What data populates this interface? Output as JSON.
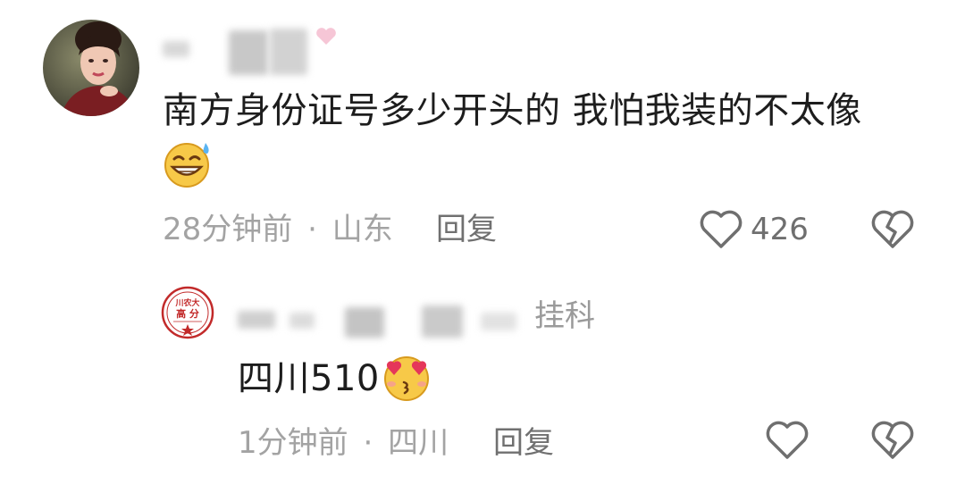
{
  "comment": {
    "text": "南方身份证号多少开头的 我怕我装的不太像",
    "emoji": "grin-sweat-emoji",
    "time": "28分钟前",
    "separator": "·",
    "location": "山东",
    "reply_label": "回复",
    "likes": "426"
  },
  "reply": {
    "author_suffix": "挂科",
    "text": "四川510",
    "emoji": "heart-eyes-kiss-emoji",
    "time": "1分钟前",
    "separator": "·",
    "location": "四川",
    "reply_label": "回复",
    "avatar_lines": [
      "川农大",
      "高 分"
    ]
  },
  "colors": {
    "meta_gray": "#a3a3a3",
    "icon_gray": "#6f6f6f",
    "emoji_yellow": "#f7c948",
    "heart_red": "#e5365a"
  }
}
